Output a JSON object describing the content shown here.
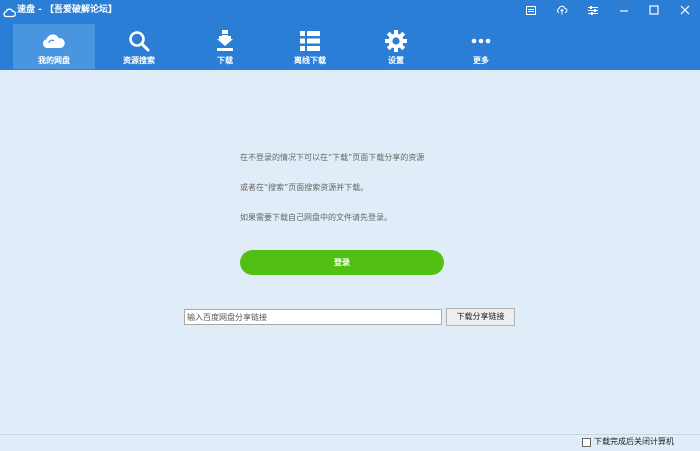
{
  "window": {
    "title": "速盘 - 【吾爱破解论坛】",
    "icon": "cloud-icon",
    "controls": [
      "card-icon",
      "upload-icon",
      "settings-list-icon",
      "minimize-icon",
      "maximize-icon",
      "close-icon"
    ]
  },
  "toolbar": {
    "items": [
      {
        "label": "我的网盘",
        "icon": "cloud-icon",
        "active": true
      },
      {
        "label": "资源搜索",
        "icon": "search-icon",
        "active": false
      },
      {
        "label": "下载",
        "icon": "download-icon",
        "active": false
      },
      {
        "label": "离线下载",
        "icon": "list-icon",
        "active": false
      },
      {
        "label": "设置",
        "icon": "gear-icon",
        "active": false
      },
      {
        "label": "更多",
        "icon": "more-icon",
        "active": false
      }
    ]
  },
  "main": {
    "hint_lines": [
      "在不登录的情况下可以在“下载”页面下载分享的资源",
      "或者在“搜索”页面搜索资源并下载。",
      "如果需要下载自己网盘中的文件请先登录。"
    ],
    "login_label": "登录",
    "share_link": {
      "placeholder": "输入百度网盘分享链接",
      "value": "",
      "button_label": "下载分享链接"
    }
  },
  "status": {
    "shutdown_label": "下载完成后关闭计算机",
    "shutdown_checked": false
  },
  "colors": {
    "accent": "#2b7ed5",
    "active_tab": "#4a95e0",
    "background": "#e0ecf8",
    "login_button": "#52bf13"
  }
}
